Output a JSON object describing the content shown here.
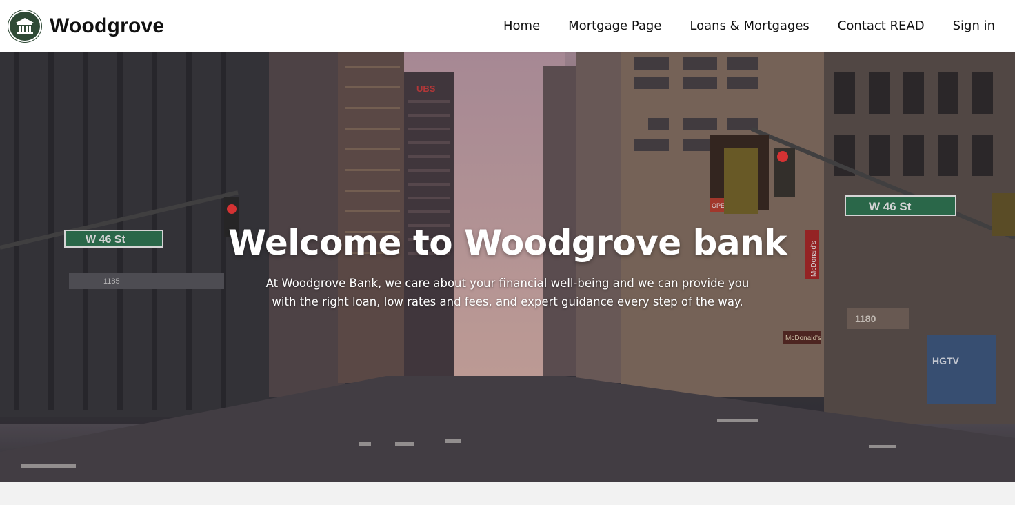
{
  "header": {
    "brand_name": "Woodgrove",
    "logo_icon": "bank-building-icon",
    "nav": [
      {
        "label": "Home"
      },
      {
        "label": "Mortgage Page"
      },
      {
        "label": "Loans & Mortgages"
      },
      {
        "label": "Contact READ"
      },
      {
        "label": "Sign in"
      }
    ]
  },
  "hero": {
    "title": "Welcome to Woodgrove bank",
    "description": "At Woodgrove Bank, we care about your financial well-being and we can provide you with the right loan, low rates and fees, and expert guidance every step of the way.",
    "signs": {
      "left_street_sign": "W 46 St",
      "right_street_sign": "W 46 St",
      "left_building_number": "1185",
      "right_building_number": "1180",
      "ubs_sign": "UBS",
      "mcdonalds_vertical": "McDonald's",
      "mcdonalds_storefront": "McDonald's",
      "hgtv_billboard": "HGTV",
      "opel_sign": "OPEL"
    }
  },
  "colors": {
    "header_bg": "#ffffff",
    "logo_bg": "#2f4a36",
    "text_dark": "#111111",
    "hero_text": "#ffffff",
    "street_sign_green": "#2f7a55",
    "page_bg": "#f2f2f2"
  }
}
